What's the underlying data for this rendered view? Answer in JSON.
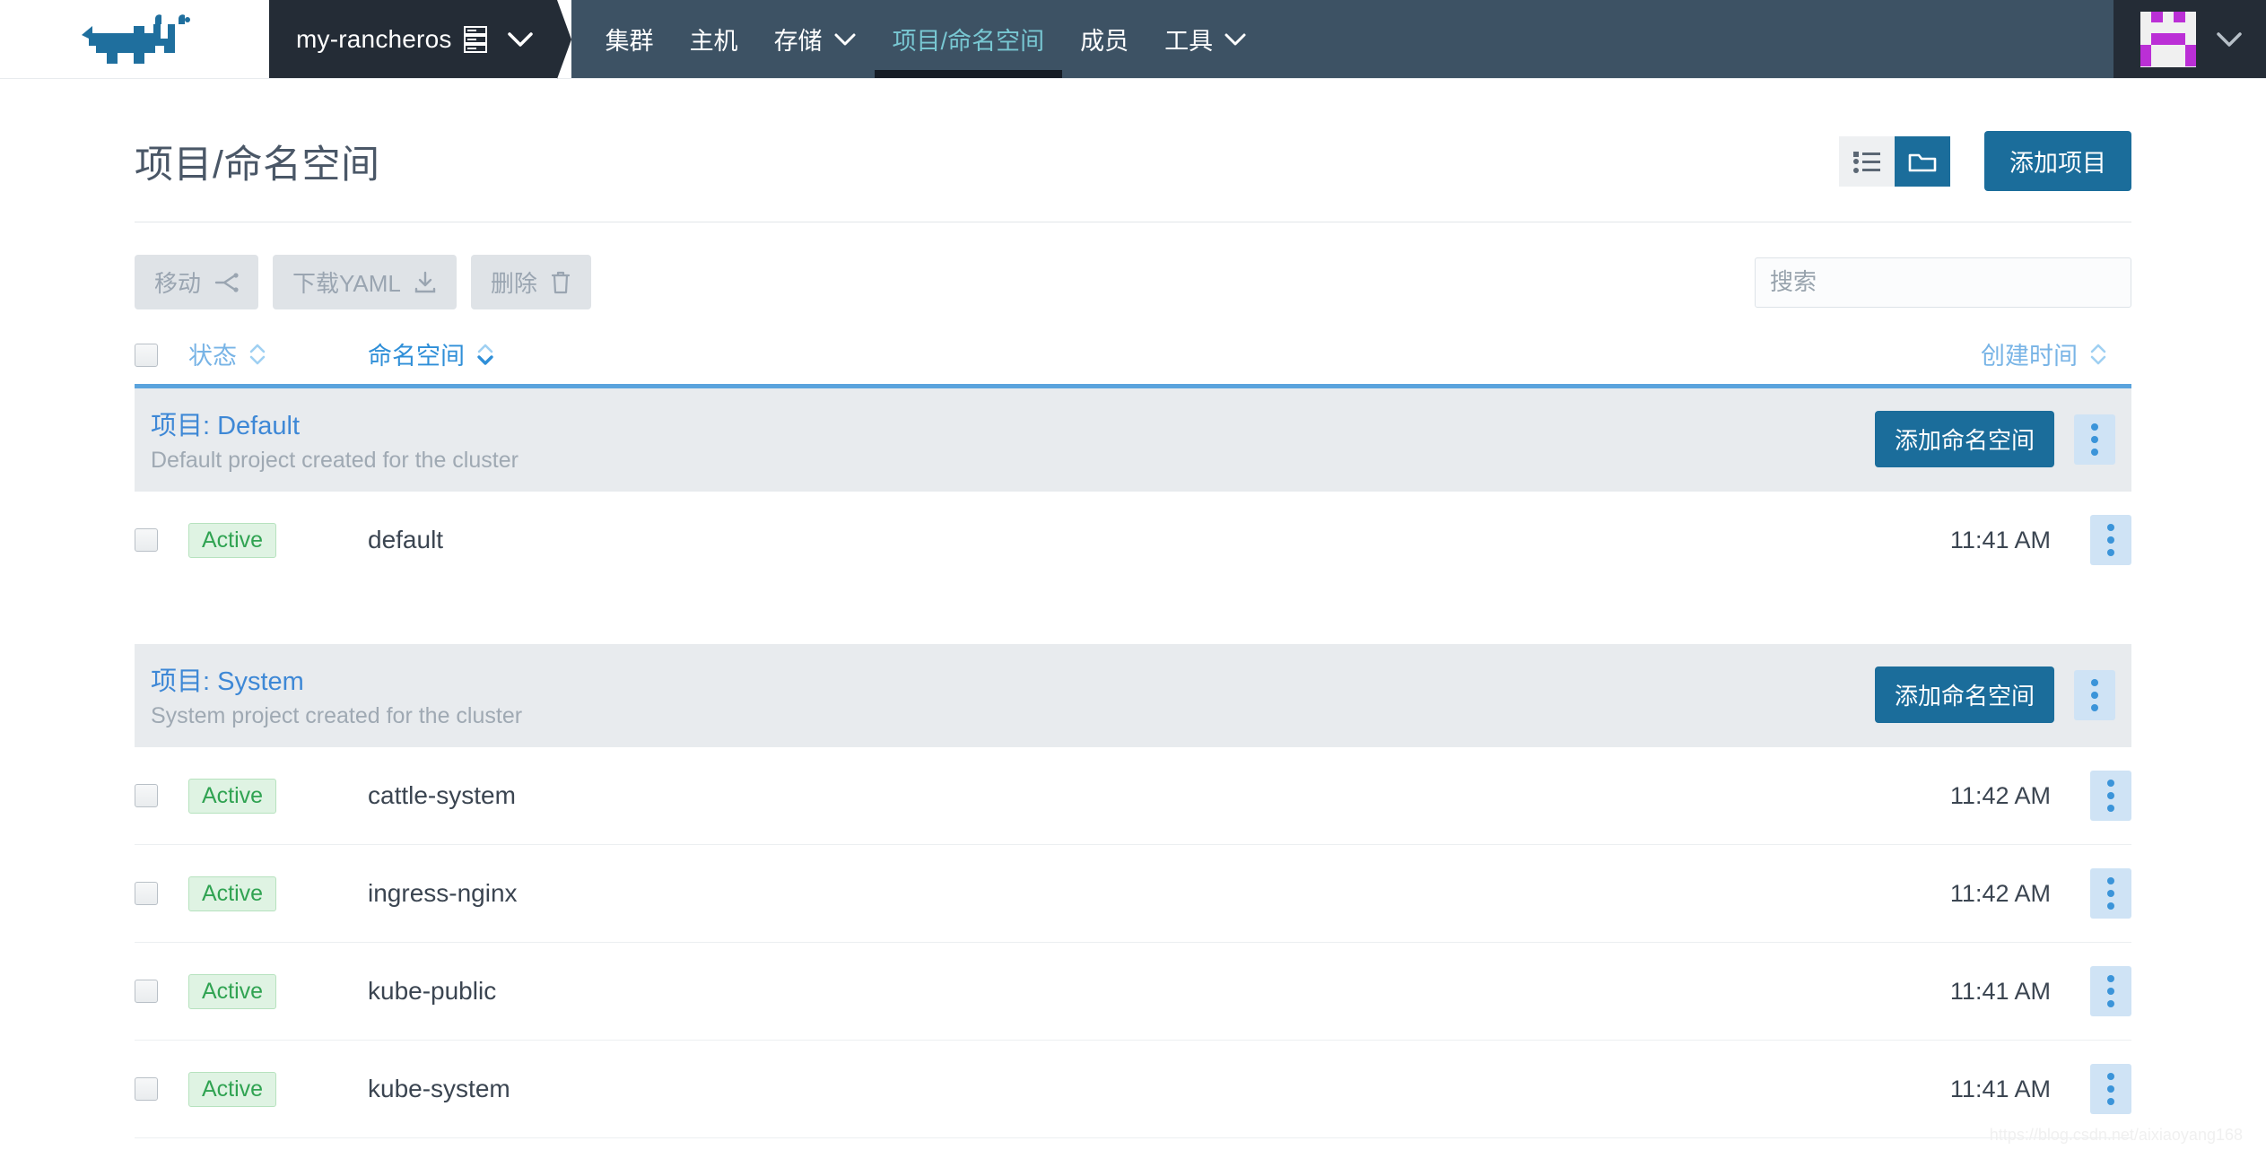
{
  "navbar": {
    "logo_name": "rancher-cow-logo",
    "cluster": {
      "name": "my-rancheros",
      "icon": "server-rack-icon",
      "caret": "chevron-down-icon"
    },
    "items": [
      {
        "label": "集群",
        "active": false,
        "caret": false
      },
      {
        "label": "主机",
        "active": false,
        "caret": false
      },
      {
        "label": "存储",
        "active": false,
        "caret": true
      },
      {
        "label": "项目/命名空间",
        "active": true,
        "caret": false
      },
      {
        "label": "成员",
        "active": false,
        "caret": false
      },
      {
        "label": "工具",
        "active": false,
        "caret": true
      }
    ],
    "user": {
      "avatar": "identicon-avatar",
      "caret": "chevron-down-icon"
    },
    "colors": {
      "cluster_bg": "#242c36",
      "nav_bg": "#3d5264",
      "active_text": "#78c7d2",
      "active_underline": "#151c25"
    }
  },
  "header": {
    "title": "项目/命名空间",
    "view_list_icon": "list-view-icon",
    "view_group_icon": "folder-group-view-icon",
    "add_project_label": "添加项目"
  },
  "toolbar": {
    "move_label": "移动",
    "move_icon": "move-shuffle-icon",
    "download_label": "下载YAML",
    "download_icon": "download-icon",
    "delete_label": "删除",
    "delete_icon": "trash-icon",
    "search_placeholder": "搜索",
    "search_value": ""
  },
  "table": {
    "columns": {
      "state": "状态",
      "namespace": "命名空间",
      "created": "创建时间"
    },
    "sort": {
      "column": "命名空间",
      "direction": "desc"
    },
    "add_namespace_label": "添加命名空间",
    "groups": [
      {
        "title": "项目: Default",
        "description": "Default project created for the cluster",
        "rows": [
          {
            "state": "Active",
            "name": "default",
            "created": "11:41 AM"
          }
        ]
      },
      {
        "title": "项目: System",
        "description": "System project created for the cluster",
        "rows": [
          {
            "state": "Active",
            "name": "cattle-system",
            "created": "11:42 AM"
          },
          {
            "state": "Active",
            "name": "ingress-nginx",
            "created": "11:42 AM"
          },
          {
            "state": "Active",
            "name": "kube-public",
            "created": "11:41 AM"
          },
          {
            "state": "Active",
            "name": "kube-system",
            "created": "11:41 AM"
          }
        ]
      }
    ]
  },
  "watermark": "https://blog.csdn.net/aixiaoyang168",
  "accent": {
    "primary": "#1b6d9b",
    "link": "#3e88d6",
    "success": "#30a352"
  }
}
